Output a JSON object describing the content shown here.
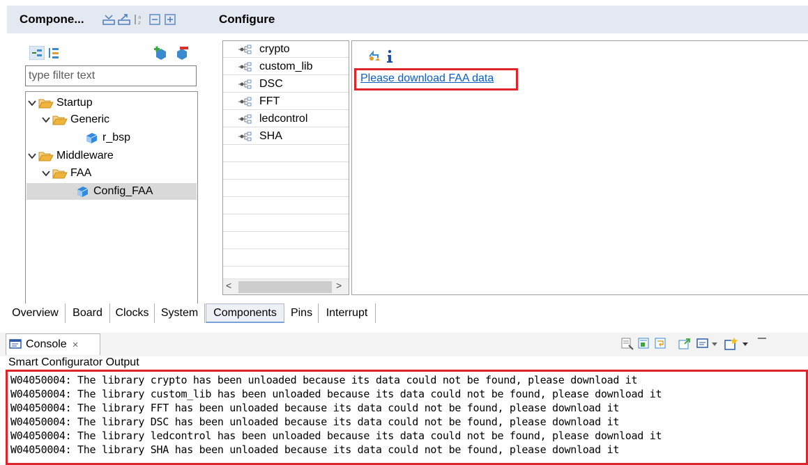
{
  "components": {
    "title": "Compone...",
    "filter_placeholder": "type filter text",
    "tree": [
      {
        "label": "Startup"
      },
      {
        "label": "Generic"
      },
      {
        "label": "r_bsp"
      },
      {
        "label": "Middleware"
      },
      {
        "label": "FAA"
      },
      {
        "label": "Config_FAA"
      }
    ]
  },
  "configure": {
    "title": "Configure",
    "libraries": [
      "crypto",
      "custom_lib",
      "DSC",
      "FFT",
      "ledcontrol",
      "SHA"
    ],
    "download_link": "Please download FAA data",
    "scroll_left": "<",
    "scroll_right": ">"
  },
  "tabs": [
    "Overview",
    "Board",
    "Clocks",
    "System",
    "Components",
    "Pins",
    "Interrupt"
  ],
  "active_tab": "Components",
  "console": {
    "tab_label": "Console",
    "close_glyph": "×",
    "output_title": "Smart Configurator Output",
    "lines": [
      "W04050004: The library crypto has been unloaded because its data could not be found, please download it",
      "W04050004: The library custom_lib has been unloaded because its data could not be found, please download it",
      "W04050004: The library FFT has been unloaded because its data could not be found, please download it",
      "W04050004: The library DSC has been unloaded because its data could not be found, please download it",
      "W04050004: The library ledcontrol has been unloaded because its data could not be found, please download it",
      "W04050004: The library SHA has been unloaded because its data could not be found, please download it"
    ]
  },
  "colors": {
    "highlight": "#e0242c",
    "link": "#0b5fc4",
    "header_bg": "#e4e9f1",
    "folder": "#f0b43c"
  }
}
